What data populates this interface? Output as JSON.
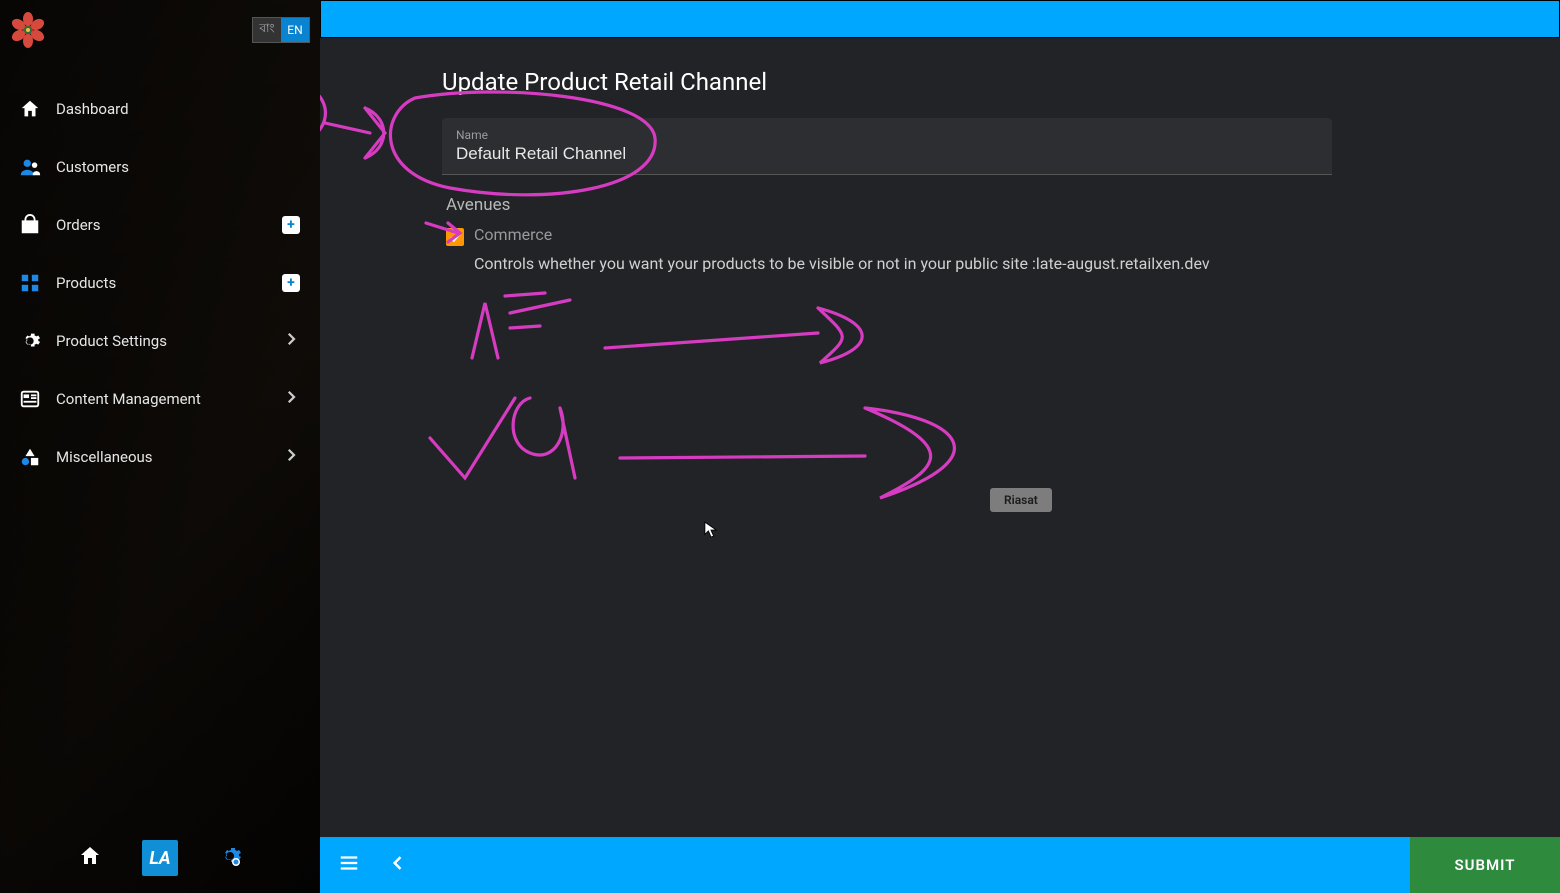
{
  "lang": {
    "inactive": "বাং",
    "active": "EN"
  },
  "sidebar": {
    "items": [
      {
        "label": "Dashboard"
      },
      {
        "label": "Customers"
      },
      {
        "label": "Orders"
      },
      {
        "label": "Products"
      },
      {
        "label": "Product Settings"
      },
      {
        "label": "Content Management"
      },
      {
        "label": "Miscellaneous"
      }
    ],
    "bottom_badge": "LA"
  },
  "page": {
    "title": "Update Product Retail Channel",
    "name_label": "Name",
    "name_value": "Default Retail Channel",
    "avenues_label": "Avenues",
    "avenue_commerce": "Commerce",
    "avenue_commerce_checked": true,
    "avenue_desc": "Controls whether you want your products to be visible or not in your public site :late-august.retailxen.dev"
  },
  "user_tag": "Riasat",
  "bottombar": {
    "submit": "SUBMIT"
  },
  "colors": {
    "accent_blue": "#00a7ff",
    "submit_green": "#2e8b3e",
    "checkbox_orange": "#ff9800",
    "annotation_magenta": "#d63cc1"
  }
}
